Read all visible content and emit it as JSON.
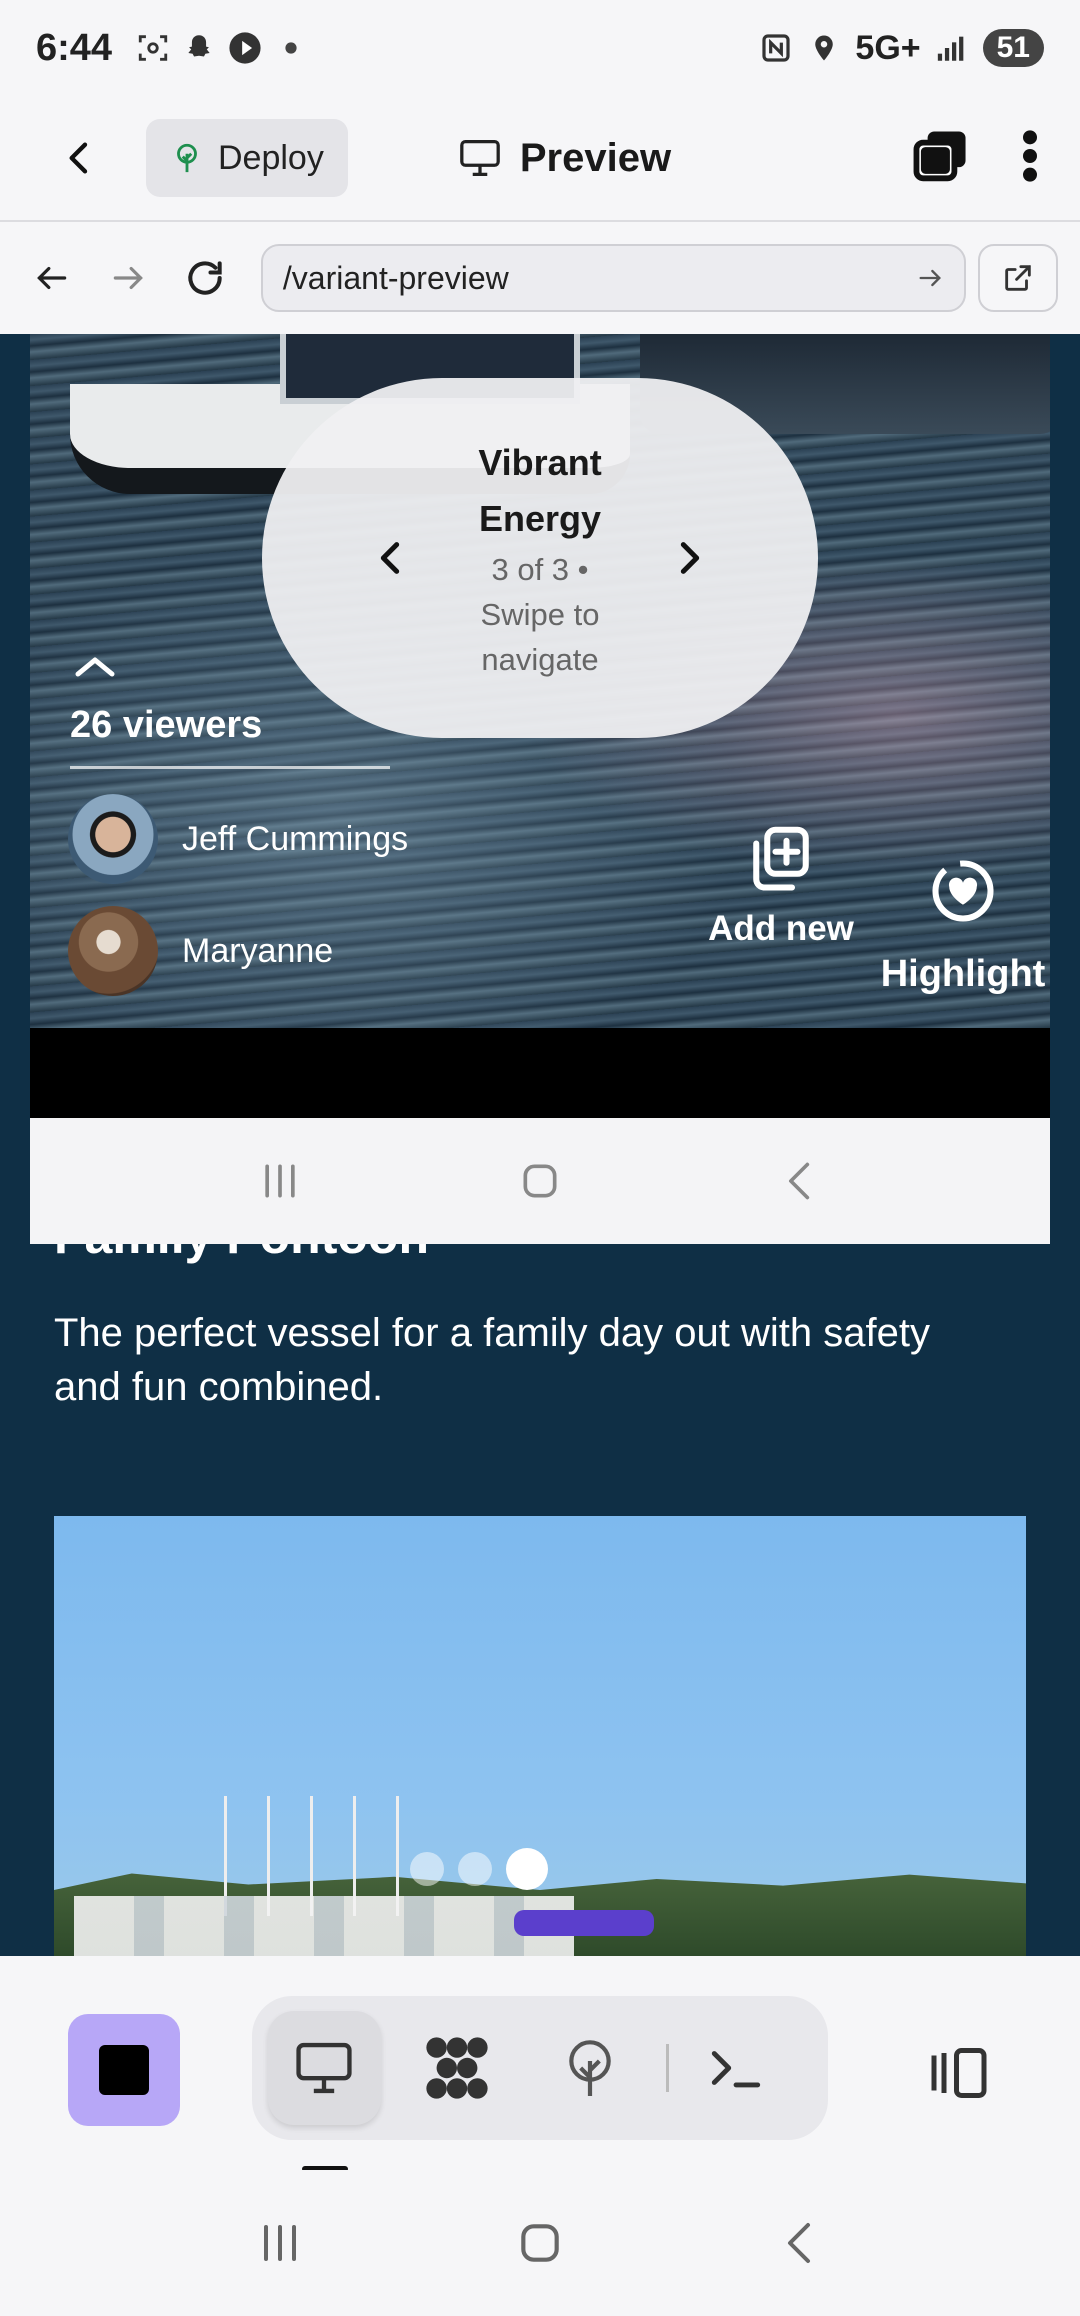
{
  "status_bar": {
    "time": "6:44",
    "network": "5G+",
    "battery": "51"
  },
  "header": {
    "deploy_label": "Deploy",
    "preview_label": "Preview"
  },
  "browser": {
    "url": "/variant-preview"
  },
  "story": {
    "variant_name": "Vibrant Energy",
    "variant_sub": "3 of 3 • Swipe to navigate",
    "viewers_count": "26 viewers",
    "viewers": [
      {
        "name": "Jeff Cummings"
      },
      {
        "name": "Maryanne"
      }
    ],
    "add_new_label": "Add new",
    "highlight_label": "Highlight"
  },
  "content": {
    "section_title": "Family Pontoon",
    "description": "The perfect vessel for a family day out with safety and fun combined.",
    "carousel_total": 3,
    "carousel_active": 3
  },
  "toolbar": {
    "tools": [
      "desktop-preview",
      "components",
      "deploy",
      "terminal"
    ],
    "active_tool": "desktop-preview"
  },
  "colors": {
    "accent": "#b7a7f7",
    "page_bg": "#0f2f45",
    "chrome_bg": "#f6f6f8"
  }
}
